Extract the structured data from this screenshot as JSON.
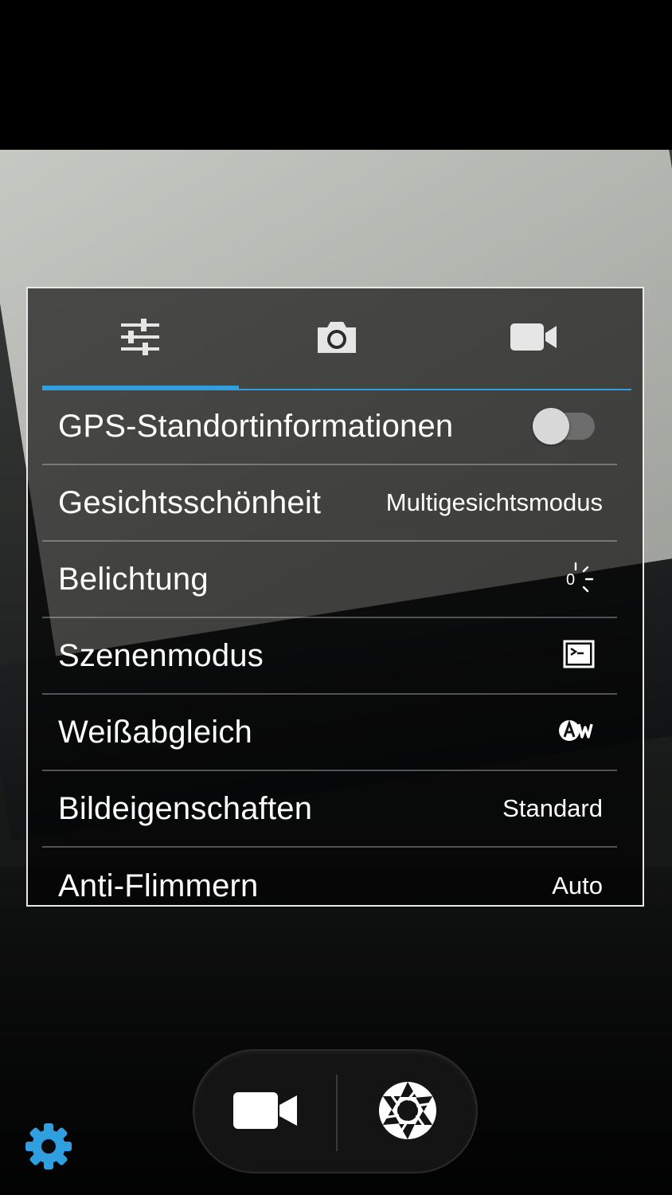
{
  "tabs": [
    {
      "icon": "sliders-icon",
      "active": true
    },
    {
      "icon": "camera-icon",
      "active": false
    },
    {
      "icon": "video-camera-icon",
      "active": false
    }
  ],
  "settings": [
    {
      "label": "GPS-Standortinformationen",
      "value": "",
      "control": "toggle",
      "toggle_on": false
    },
    {
      "label": "Gesichtsschönheit",
      "value": "Multigesichtsmodus"
    },
    {
      "label": "Belichtung",
      "value": "0",
      "icon": "exposure-icon"
    },
    {
      "label": "Szenenmodus",
      "value": "",
      "icon": "scene-mode-icon"
    },
    {
      "label": "Weißabgleich",
      "value": "",
      "icon": "auto-white-balance-icon"
    },
    {
      "label": "Bildeigenschaften",
      "value": "Standard"
    },
    {
      "label": "Anti-Flimmern",
      "value": "Auto"
    }
  ],
  "bottom_controls": {
    "video_icon": "video-camera-icon",
    "shutter_icon": "shutter-icon",
    "settings_icon": "gear-icon"
  },
  "colors": {
    "accent": "#2f9fe0",
    "panel_border": "#e8e8e8",
    "toggle_off_track": "#6d6d6d",
    "gear": "#2f9fe0"
  }
}
